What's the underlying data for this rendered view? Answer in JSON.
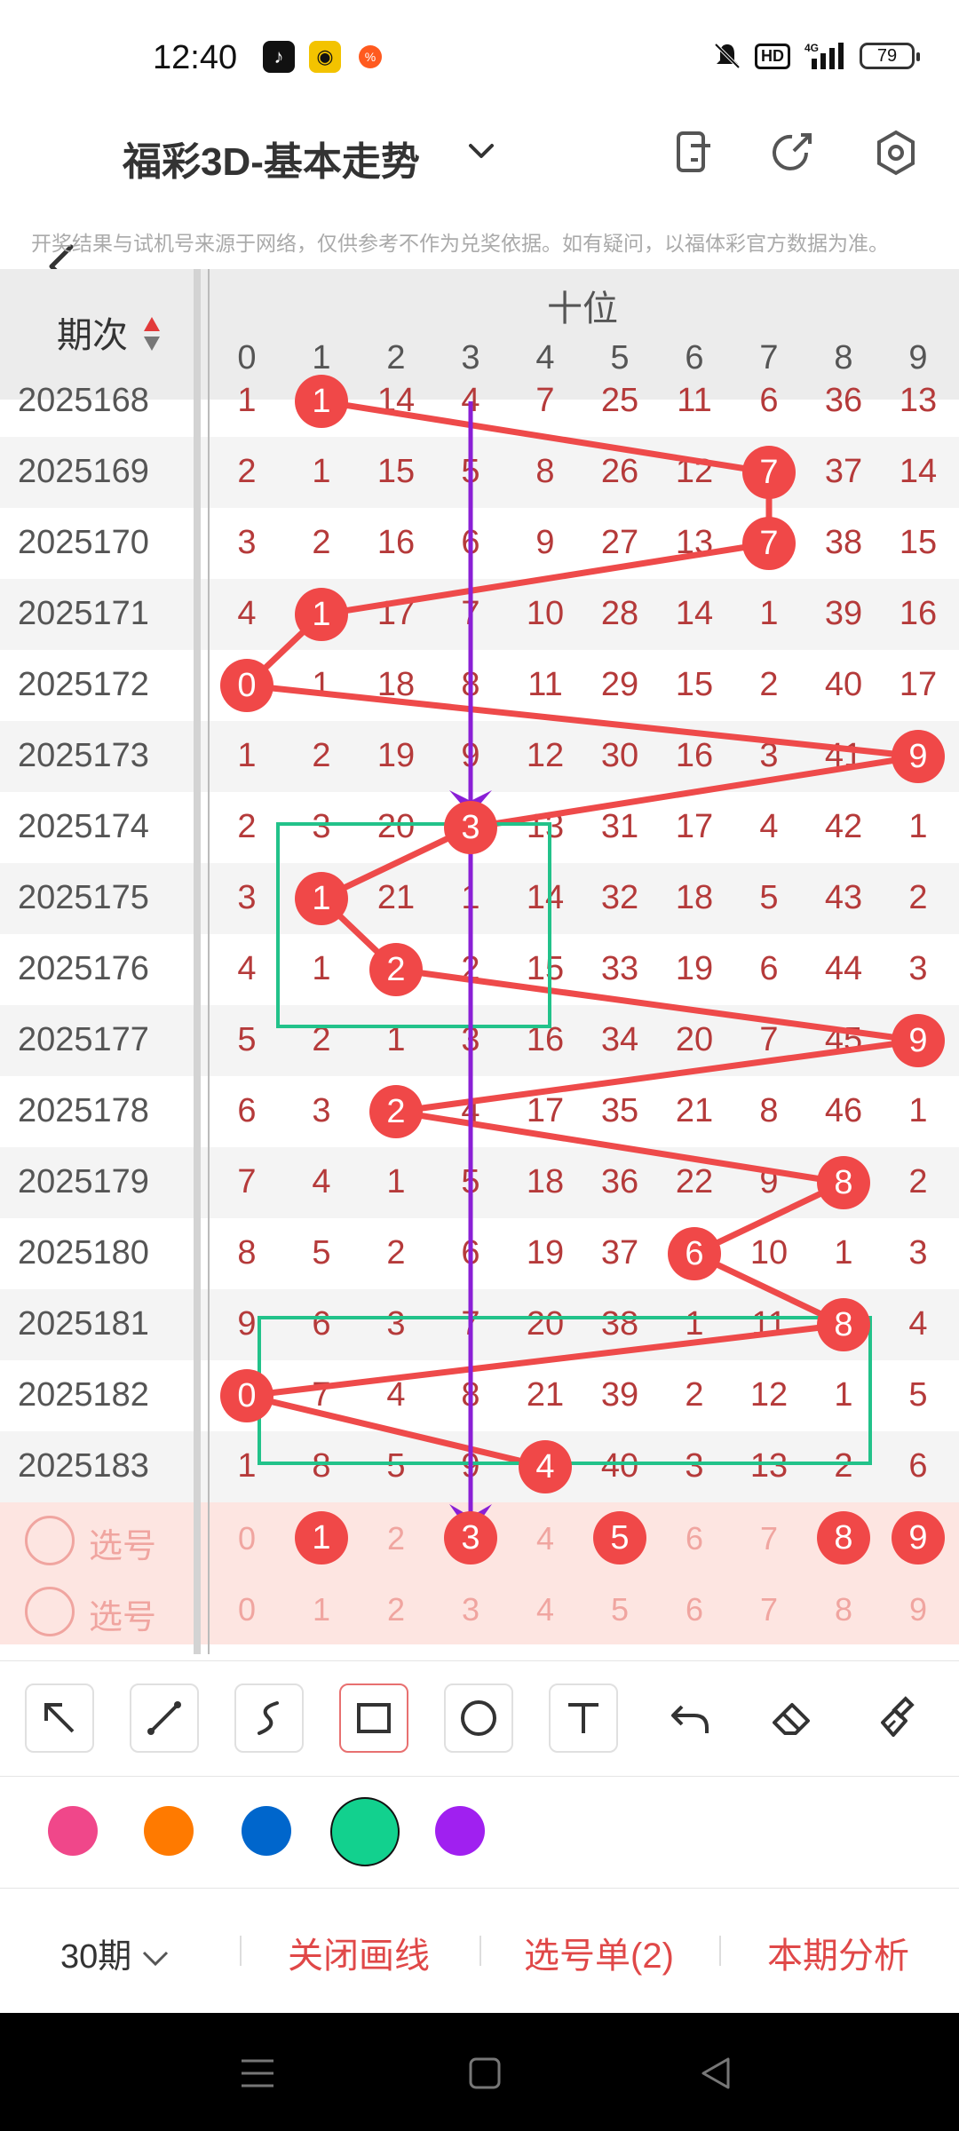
{
  "status": {
    "time": "12:40",
    "hd": "HD",
    "network": "4G",
    "battery": "79"
  },
  "header": {
    "title": "福彩3D-基本走势"
  },
  "disclaimer": "开奖结果与试机号来源于网络，仅供参考不作为兑奖依据。如有疑问，以福体彩官方数据为准。",
  "table": {
    "col_label": "期次",
    "group_label": "十位",
    "digits": [
      "0",
      "1",
      "2",
      "3",
      "4",
      "5",
      "6",
      "7",
      "8",
      "9"
    ],
    "rows": [
      {
        "period": "2025168",
        "cells": [
          "1",
          "1",
          "14",
          "4",
          "7",
          "25",
          "11",
          "6",
          "36",
          "13"
        ],
        "hit": 1
      },
      {
        "period": "2025169",
        "cells": [
          "2",
          "1",
          "15",
          "5",
          "8",
          "26",
          "12",
          "7",
          "37",
          "14"
        ],
        "hit": 7
      },
      {
        "period": "2025170",
        "cells": [
          "3",
          "2",
          "16",
          "6",
          "9",
          "27",
          "13",
          "7",
          "38",
          "15"
        ],
        "hit": 7
      },
      {
        "period": "2025171",
        "cells": [
          "4",
          "1",
          "17",
          "7",
          "10",
          "28",
          "14",
          "1",
          "39",
          "16"
        ],
        "hit": 1
      },
      {
        "period": "2025172",
        "cells": [
          "0",
          "1",
          "18",
          "8",
          "11",
          "29",
          "15",
          "2",
          "40",
          "17"
        ],
        "hit": 0
      },
      {
        "period": "2025173",
        "cells": [
          "1",
          "2",
          "19",
          "9",
          "12",
          "30",
          "16",
          "3",
          "41",
          "9"
        ],
        "hit": 9
      },
      {
        "period": "2025174",
        "cells": [
          "2",
          "3",
          "20",
          "3",
          "13",
          "31",
          "17",
          "4",
          "42",
          "1"
        ],
        "hit": 3
      },
      {
        "period": "2025175",
        "cells": [
          "3",
          "1",
          "21",
          "1",
          "14",
          "32",
          "18",
          "5",
          "43",
          "2"
        ],
        "hit": 1
      },
      {
        "period": "2025176",
        "cells": [
          "4",
          "1",
          "2",
          "2",
          "15",
          "33",
          "19",
          "6",
          "44",
          "3"
        ],
        "hit": 2
      },
      {
        "period": "2025177",
        "cells": [
          "5",
          "2",
          "1",
          "3",
          "16",
          "34",
          "20",
          "7",
          "45",
          "9"
        ],
        "hit": 9
      },
      {
        "period": "2025178",
        "cells": [
          "6",
          "3",
          "2",
          "4",
          "17",
          "35",
          "21",
          "8",
          "46",
          "1"
        ],
        "hit": 2
      },
      {
        "period": "2025179",
        "cells": [
          "7",
          "4",
          "1",
          "5",
          "18",
          "36",
          "22",
          "9",
          "8",
          "2"
        ],
        "hit": 8
      },
      {
        "period": "2025180",
        "cells": [
          "8",
          "5",
          "2",
          "6",
          "19",
          "37",
          "6",
          "10",
          "1",
          "3"
        ],
        "hit": 6
      },
      {
        "period": "2025181",
        "cells": [
          "9",
          "6",
          "3",
          "7",
          "20",
          "38",
          "1",
          "11",
          "8",
          "4"
        ],
        "hit": 8
      },
      {
        "period": "2025182",
        "cells": [
          "0",
          "7",
          "4",
          "8",
          "21",
          "39",
          "2",
          "12",
          "1",
          "5"
        ],
        "hit": 0
      },
      {
        "period": "2025183",
        "cells": [
          "1",
          "8",
          "5",
          "9",
          "4",
          "40",
          "3",
          "13",
          "2",
          "6"
        ],
        "hit": 4
      }
    ],
    "pick_rows": [
      {
        "label": "选号",
        "cells": [
          "0",
          "1",
          "2",
          "3",
          "4",
          "5",
          "6",
          "7",
          "8",
          "9"
        ],
        "selected": [
          1,
          3,
          5,
          8,
          9
        ]
      },
      {
        "label": "选号",
        "cells": [
          "0",
          "1",
          "2",
          "3",
          "4",
          "5",
          "6",
          "7",
          "8",
          "9"
        ],
        "selected": []
      }
    ]
  },
  "tools": [
    "arrow-tool",
    "line-tool",
    "curve-tool",
    "rectangle-tool",
    "circle-tool",
    "text-tool",
    "undo",
    "eraser",
    "clear"
  ],
  "palette": [
    "#f0478a",
    "#ff7a00",
    "#0066cc",
    "#12d18e",
    "#a020f0"
  ],
  "selected_color": "#12d18e",
  "bottom": {
    "period_select": "30期",
    "close_draw": "关闭画线",
    "pick_list": "选号单(2)",
    "analysis": "本期分析"
  }
}
